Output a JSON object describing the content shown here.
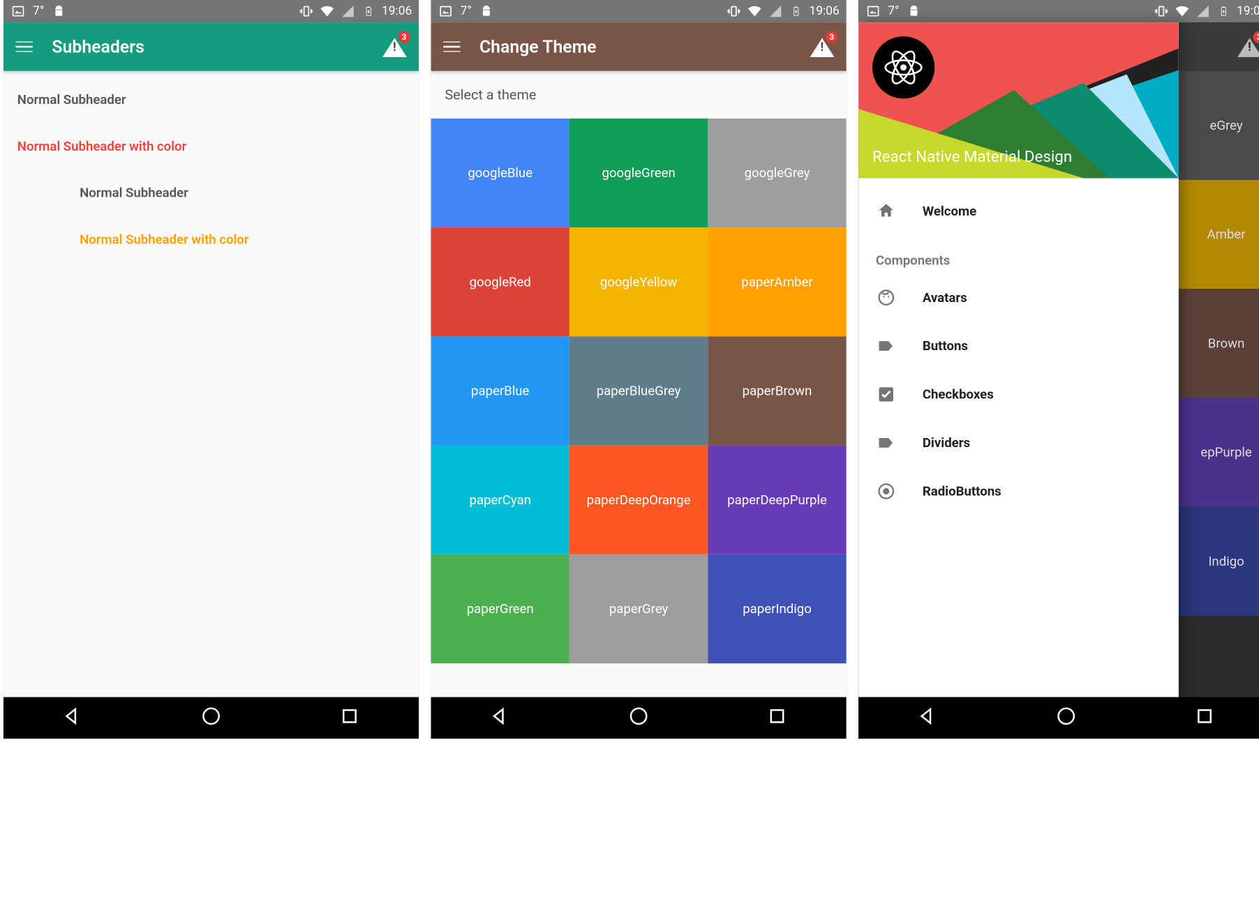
{
  "statusbar": {
    "temperature": "7°",
    "time": "19:06"
  },
  "badge_count": "3",
  "screen1": {
    "title": "Subheaders",
    "appbar_color": "#159B80",
    "items": [
      {
        "label": "Normal Subheader",
        "color": "#555555",
        "indent": false
      },
      {
        "label": "Normal Subheader with color",
        "color": "#F44336",
        "indent": false
      },
      {
        "label": "Normal Subheader",
        "color": "#555555",
        "indent": true
      },
      {
        "label": "Normal Subheader with color",
        "color": "#FFA000",
        "indent": true
      }
    ]
  },
  "screen2": {
    "title": "Change Theme",
    "appbar_color": "#795548",
    "select_label": "Select a theme",
    "themes": [
      {
        "name": "googleBlue",
        "color": "#4285F4"
      },
      {
        "name": "googleGreen",
        "color": "#0F9D58"
      },
      {
        "name": "googleGrey",
        "color": "#9E9E9E"
      },
      {
        "name": "googleRed",
        "color": "#DB4437"
      },
      {
        "name": "googleYellow",
        "color": "#F4B400"
      },
      {
        "name": "paperAmber",
        "color": "#FFA000"
      },
      {
        "name": "paperBlue",
        "color": "#2196F3"
      },
      {
        "name": "paperBlueGrey",
        "color": "#607D8B"
      },
      {
        "name": "paperBrown",
        "color": "#795548"
      },
      {
        "name": "paperCyan",
        "color": "#00BCD4"
      },
      {
        "name": "paperDeepOrange",
        "color": "#FF5722"
      },
      {
        "name": "paperDeepPurple",
        "color": "#673AB7"
      },
      {
        "name": "paperGreen",
        "color": "#4CAF50"
      },
      {
        "name": "paperGrey",
        "color": "#9E9E9E"
      },
      {
        "name": "paperIndigo",
        "color": "#3F51B5"
      }
    ]
  },
  "screen3": {
    "drawer_title": "React Native Material Design",
    "welcome_label": "Welcome",
    "section_label": "Components",
    "items": [
      {
        "icon": "face",
        "label": "Avatars"
      },
      {
        "icon": "label",
        "label": "Buttons"
      },
      {
        "icon": "checkbox",
        "label": "Checkboxes"
      },
      {
        "icon": "label",
        "label": "Dividers"
      },
      {
        "icon": "radio",
        "label": "RadioButtons"
      }
    ],
    "backdrop_themes": [
      {
        "name": "eGrey",
        "color": "#4A4A4A"
      },
      {
        "name": "Amber",
        "color": "#B28900"
      },
      {
        "name": "Brown",
        "color": "#5A4038"
      },
      {
        "name": "epPurple",
        "color": "#4A318C"
      },
      {
        "name": "Indigo",
        "color": "#2A367D"
      }
    ]
  }
}
